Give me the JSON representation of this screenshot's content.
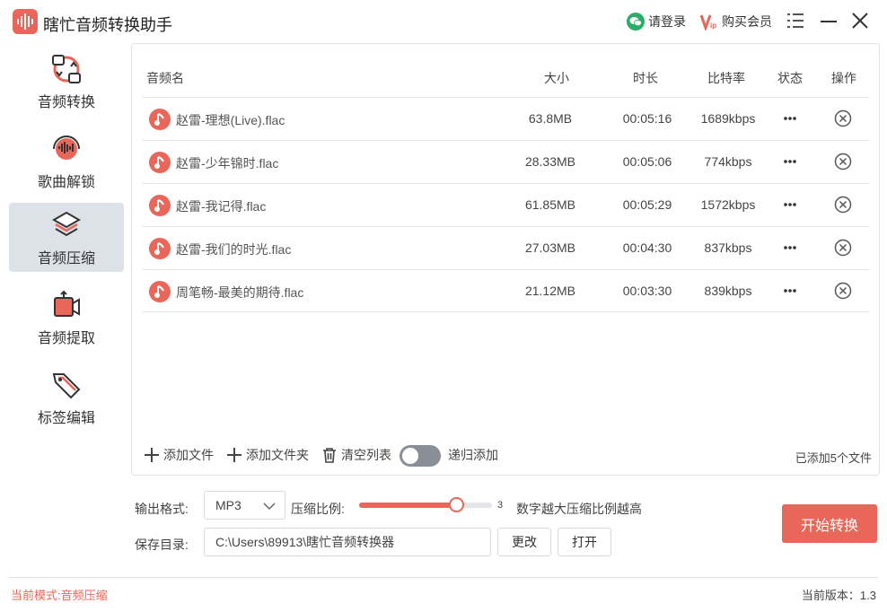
{
  "app": {
    "title": "瞎忙音频转换助手"
  },
  "titlebar": {
    "login_label": "请登录",
    "vip_label": "购买会员"
  },
  "sidebar": {
    "items": [
      {
        "label": "音频转换",
        "icon": "audio-convert-icon",
        "active": false
      },
      {
        "label": "歌曲解锁",
        "icon": "song-unlock-icon",
        "active": false
      },
      {
        "label": "音频压缩",
        "icon": "layers-icon",
        "active": true
      },
      {
        "label": "音频提取",
        "icon": "video-extract-icon",
        "active": false
      },
      {
        "label": "标签编辑",
        "icon": "tag-icon",
        "active": false
      }
    ]
  },
  "table": {
    "headers": {
      "name": "音频名",
      "size": "大小",
      "duration": "时长",
      "bitrate": "比特率",
      "status": "状态",
      "action": "操作"
    },
    "rows": [
      {
        "name": "赵雷-理想(Live).flac",
        "size": "63.8MB",
        "duration": "00:05:16",
        "bitrate": "1689kbps"
      },
      {
        "name": "赵雷-少年锦时.flac",
        "size": "28.33MB",
        "duration": "00:05:06",
        "bitrate": "774kbps"
      },
      {
        "name": "赵雷-我记得.flac",
        "size": "61.85MB",
        "duration": "00:05:29",
        "bitrate": "1572kbps"
      },
      {
        "name": "赵雷-我们的时光.flac",
        "size": "27.03MB",
        "duration": "00:04:30",
        "bitrate": "837kbps"
      },
      {
        "name": "周笔畅-最美的期待.flac",
        "size": "21.12MB",
        "duration": "00:03:30",
        "bitrate": "839kbps"
      }
    ]
  },
  "panel_actions": {
    "add_file": "添加文件",
    "add_folder": "添加文件夹",
    "clear_list": "清空列表",
    "recursive_add": "递归添加",
    "recursive_on": false,
    "file_count": "已添加5个文件"
  },
  "controls": {
    "format_label": "输出格式:",
    "format_value": "MP3",
    "ratio_label": "压缩比例:",
    "ratio_value": "3",
    "ratio_fraction": 0.73,
    "ratio_hint": "数字越大压缩比例越高",
    "dir_label": "保存目录:",
    "dir_value": "C:\\Users\\89913\\瞎忙音频转换器",
    "change_label": "更改",
    "open_label": "打开",
    "start_label": "开始转换"
  },
  "statusbar": {
    "mode": "当前模式:音频压缩",
    "version": "当前版本：1.3"
  },
  "colors": {
    "accent": "#e8665a",
    "active_bg": "#dde2e8"
  }
}
